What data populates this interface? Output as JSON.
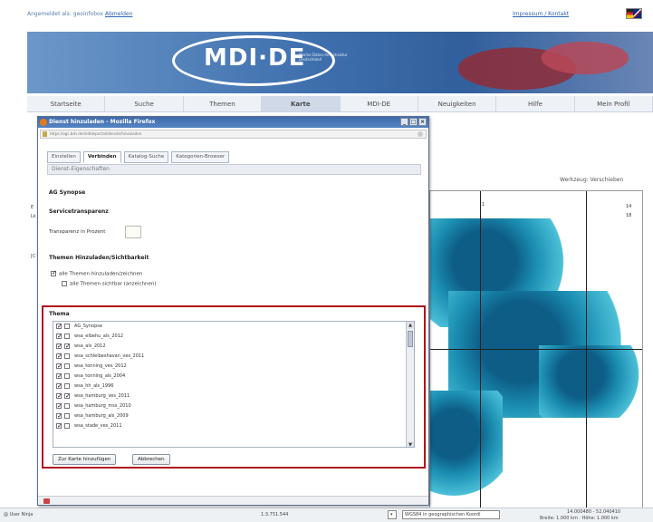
{
  "header": {
    "login_text": "Angemeldet als: geoinfobox",
    "logout_link": "Abmelden",
    "top_right_link": "Impressum / Kontakt",
    "flag_icon": "uk-de-flag-icon"
  },
  "banner": {
    "logo_text": "MDI·DE",
    "logo_subtitle": "Marine Daten-Infrastruktur Deutschland"
  },
  "nav": {
    "items": [
      "Startseite",
      "Suche",
      "Themen",
      "Karte",
      "MDI-DE",
      "Neuigkeiten",
      "Hilfe",
      "Mein Profil"
    ],
    "active": "Karte"
  },
  "background": {
    "window_title": "Werkzeug: Verschieben",
    "side_labels": [
      "E",
      "Lk",
      "[C"
    ],
    "map_numbers": [
      "1",
      "14",
      "18"
    ]
  },
  "popup": {
    "title": "Dienst hinzuladen - Mozilla Firefox",
    "url": "https://ogc.bsh.de/mdideportal/dienste/hinzuladen",
    "tabs": [
      "Einstellen",
      "Verbinden",
      "Katalog-Suche",
      "Kategorien-Browser"
    ],
    "active_tab": "Verbinden",
    "props_header": "Dienst-Eigenschaften",
    "service_name": "AG Synopse",
    "transparency_heading": "Servicetransparenz",
    "transparency_label": "Transparenz in Prozent",
    "themes_heading": "Themen Hinzuladen/Sichtbarkeit",
    "opt_load_all": "alle Themen hinzuladen/zeichnen",
    "opt_visible_all": "alle Themen sichtbar (anzeichnen)",
    "thema_label": "Thema",
    "layers": [
      {
        "name": "AG_Synopse",
        "c1": true,
        "c2": false
      },
      {
        "name": "wsa_elbehu_als_2012",
        "c1": true,
        "c2": false
      },
      {
        "name": "wsa_als_2012",
        "c1": true,
        "c2": true
      },
      {
        "name": "wsa_schleibeshavan_ves_2011",
        "c1": true,
        "c2": false
      },
      {
        "name": "wsa_tonning_ves_2012",
        "c1": true,
        "c2": false
      },
      {
        "name": "wsa_tonning_als_2004",
        "c1": true,
        "c2": false
      },
      {
        "name": "wsa_hh_als_1996",
        "c1": true,
        "c2": false
      },
      {
        "name": "wsa_hamburg_ves_2011",
        "c1": true,
        "c2": true
      },
      {
        "name": "wsa_hamburg_mss_2010",
        "c1": true,
        "c2": false
      },
      {
        "name": "wsa_hamburg_als_2009",
        "c1": true,
        "c2": false
      },
      {
        "name": "wsa_stade_ves_2011",
        "c1": true,
        "c2": false
      }
    ],
    "add_button": "Zur Karte hinzufügen",
    "cancel_button": "Abbrechen"
  },
  "status": {
    "left": "@ User Ninja",
    "scale": "1:3.751.544",
    "crs": "WGS84 in geographischen Koordi",
    "coords": "14.000480 - 52.040410",
    "coords2": "Breite: 1.000 km · Höhe: 1.000 km"
  }
}
